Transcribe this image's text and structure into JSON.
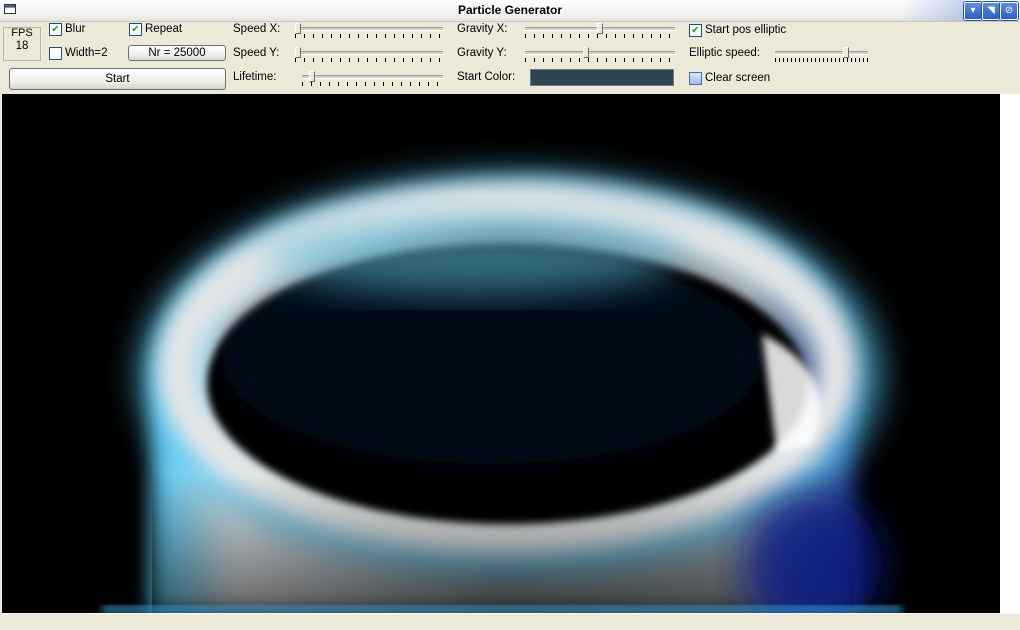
{
  "window": {
    "title": "Particle Generator"
  },
  "fps": {
    "label": "FPS",
    "value": "18"
  },
  "controls": {
    "blur": {
      "label": "Blur",
      "checked": true
    },
    "repeat": {
      "label": "Repeat",
      "checked": true
    },
    "width2": {
      "label": "Width=2",
      "checked": false
    },
    "nr_button": {
      "label": "Nr = 25000"
    },
    "start_button": {
      "label": "Start"
    },
    "start_pos_elliptic": {
      "label": "Start pos elliptic",
      "checked": true
    },
    "clear_screen": {
      "label": "Clear screen",
      "checked": false
    }
  },
  "sliders": {
    "speed_x": {
      "label": "Speed X:",
      "value": 0.0
    },
    "speed_y": {
      "label": "Speed Y:",
      "value": 0.0
    },
    "lifetime": {
      "label": "Lifetime:",
      "value": 0.05
    },
    "gravity_x": {
      "label": "Gravity X:",
      "value": 0.5
    },
    "gravity_y": {
      "label": "Gravity Y:",
      "value": 0.4
    },
    "elliptic_speed": {
      "label": "Elliptic speed:",
      "value": 0.78
    }
  },
  "start_color": {
    "label": "Start Color:",
    "value": "#2e4652"
  },
  "colors": {
    "canvas_bg": "#000000",
    "glow": "#55c8ff",
    "ring": "#d8d8d8"
  },
  "icons": {
    "app": "app-window-icon",
    "minimize": "minimize-icon",
    "maximize": "maximize-icon",
    "close": "close-icon"
  }
}
